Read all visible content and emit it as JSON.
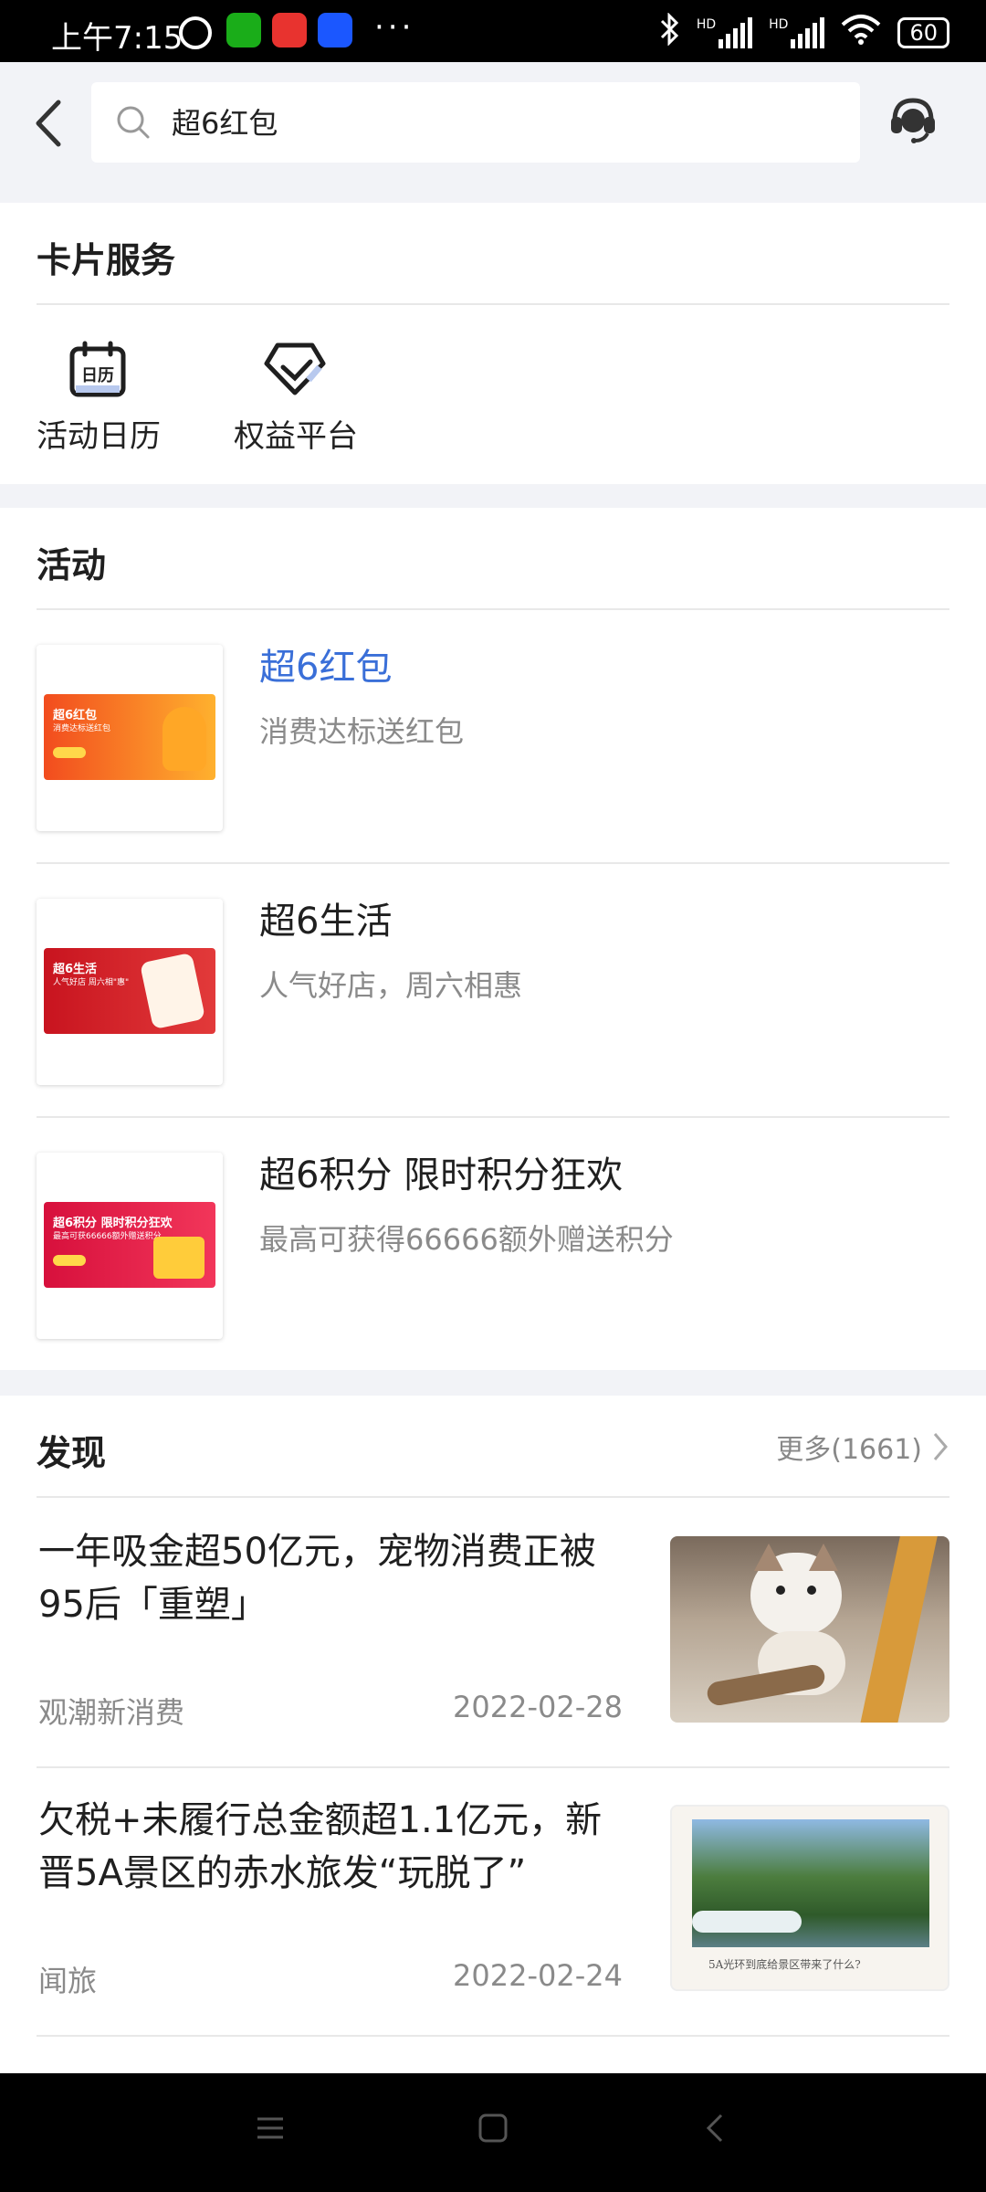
{
  "status_bar": {
    "time": "上午7:15",
    "dots": "···",
    "hd1": "HD",
    "hd2": "HD",
    "battery": "60"
  },
  "header": {
    "search_value": "超6红包"
  },
  "card_service": {
    "title": "卡片服务",
    "items": [
      {
        "label": "活动日历",
        "icon": "calendar-icon",
        "icon_text": "日历"
      },
      {
        "label": "权益平台",
        "icon": "diamond-check-icon"
      }
    ]
  },
  "activities": {
    "title": "活动",
    "items": [
      {
        "title": "超6红包",
        "subtitle": "消费达标送红包",
        "banner_title": "超6红包",
        "banner_sub": "消费达标送红包",
        "highlight": true
      },
      {
        "title": "超6生活",
        "subtitle": "人气好店，周六相惠",
        "banner_title": "超6生活",
        "banner_sub": "人气好店 周六相\"惠\"",
        "highlight": false
      },
      {
        "title": "超6积分 限时积分狂欢",
        "subtitle": "最高可获得66666额外赠送积分",
        "banner_title": "超6积分  限时积分狂欢",
        "banner_sub": "最高可获66666额外赠送积分",
        "highlight": false
      }
    ]
  },
  "discover": {
    "title": "发现",
    "more": "更多(1661)",
    "items": [
      {
        "title": "一年吸金超50亿元，宠物消费正被95后「重塑」",
        "source": "观潮新消费",
        "date": "2022-02-28"
      },
      {
        "title": "欠税+未履行总金额超1.1亿元，新晋5A景区的赤水旅发“玩脱了”",
        "source": "闻旅",
        "date": "2022-02-24",
        "image_caption": "5A光环到底给景区带来了什么?"
      }
    ]
  },
  "colors": {
    "accent": "#3a6fd8",
    "background": "#f2f3f7"
  }
}
